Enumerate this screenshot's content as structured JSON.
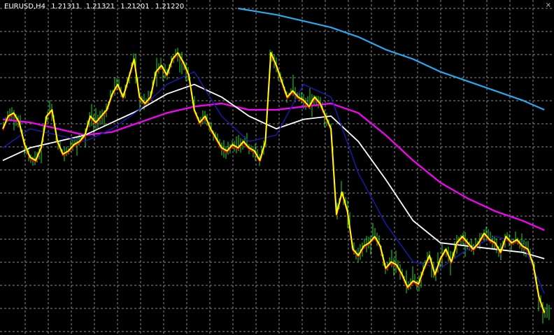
{
  "header": {
    "symbol": "EURUSD,H4",
    "open": "1.21311",
    "high": "1.21321",
    "low": "1.21201",
    "close": "1.21220"
  },
  "window": {
    "close_glyph": "×"
  },
  "colors": {
    "background": "#000000",
    "grid": "#8a8a8a",
    "candle_wick": "#22dd22",
    "price_line": "#ffff00",
    "price_shadow": "#dd0000",
    "ma_fast": "#1a1aa8",
    "ma_mid": "#ffffff",
    "ma_slow": "#ff00ff",
    "ma_long": "#28a8ee"
  },
  "chart_data": {
    "type": "line",
    "x_range": [
      0,
      100
    ],
    "y_range": [
      0,
      100
    ],
    "series": [
      {
        "key": "price",
        "x": [
          0,
          1,
          2,
          3,
          4,
          5,
          6,
          7,
          8,
          9,
          10,
          11,
          12,
          13,
          14,
          15,
          16,
          17,
          18,
          19,
          20,
          21,
          22,
          23,
          24,
          25,
          26,
          27,
          28,
          29,
          30,
          31,
          32,
          33,
          34,
          35,
          36,
          37,
          38,
          39,
          40,
          41,
          42,
          43,
          44,
          45,
          46,
          47,
          48,
          49,
          50,
          51,
          52,
          53,
          54,
          55,
          56,
          57,
          58,
          59,
          60,
          61,
          62,
          63,
          64,
          65,
          66,
          67,
          68,
          69,
          70,
          71,
          72,
          73,
          74,
          75,
          76,
          77,
          78,
          79,
          80,
          81,
          82,
          83,
          84,
          85,
          86,
          87,
          88,
          89,
          90,
          91,
          92,
          93,
          94,
          95,
          96,
          97,
          98,
          99
        ],
        "values": [
          62,
          66,
          67,
          64,
          57,
          53,
          52,
          56,
          66,
          68,
          58,
          54,
          55,
          57,
          58,
          60,
          66,
          64,
          66,
          68,
          73,
          76,
          72,
          78,
          84,
          72,
          70,
          72,
          80,
          82,
          79,
          84,
          86,
          83,
          79,
          68,
          64,
          66,
          62,
          59,
          56,
          55,
          57,
          56,
          58,
          56,
          55,
          52,
          58,
          86,
          82,
          77,
          72,
          74,
          72,
          71,
          69,
          72,
          70,
          66,
          62,
          35,
          42,
          36,
          24,
          22,
          25,
          26,
          28,
          25,
          18,
          20,
          19,
          16,
          12,
          14,
          13,
          18,
          22,
          16,
          21,
          24,
          20,
          26,
          28,
          26,
          24,
          26,
          29,
          27,
          26,
          23,
          28,
          26,
          27,
          25,
          24,
          19,
          9,
          4
        ]
      },
      {
        "key": "ma_fast",
        "x": [
          0,
          5,
          10,
          15,
          20,
          25,
          30,
          35,
          40,
          45,
          50,
          55,
          60,
          65,
          70,
          75,
          80,
          85,
          90,
          95,
          99
        ],
        "values": [
          56,
          62,
          60,
          58,
          62,
          68,
          76,
          80,
          66,
          58,
          60,
          76,
          72,
          48,
          32,
          20,
          18,
          24,
          28,
          26,
          10
        ]
      },
      {
        "key": "ma_mid",
        "x": [
          0,
          5,
          10,
          15,
          20,
          25,
          30,
          35,
          40,
          45,
          50,
          55,
          60,
          65,
          70,
          75,
          80,
          85,
          90,
          95,
          99
        ],
        "values": [
          52,
          56,
          58,
          60,
          64,
          68,
          73,
          76,
          72,
          66,
          62,
          65,
          66,
          58,
          46,
          33,
          26,
          25,
          24,
          23,
          21
        ]
      },
      {
        "key": "ma_slow",
        "x": [
          0,
          5,
          10,
          15,
          20,
          25,
          30,
          35,
          40,
          45,
          50,
          55,
          60,
          65,
          70,
          75,
          80,
          85,
          90,
          95,
          99
        ],
        "values": [
          65,
          64,
          62,
          60,
          61,
          64,
          67,
          69,
          70,
          68,
          68,
          69,
          70,
          67,
          60,
          52,
          45,
          40,
          36,
          33,
          30
        ]
      },
      {
        "key": "ma_long",
        "x": [
          43,
          50,
          55,
          60,
          65,
          70,
          75,
          80,
          85,
          90,
          95,
          99
        ],
        "values": [
          100,
          98,
          96,
          94,
          91,
          87,
          84,
          80,
          77,
          74,
          71,
          68
        ]
      }
    ]
  }
}
